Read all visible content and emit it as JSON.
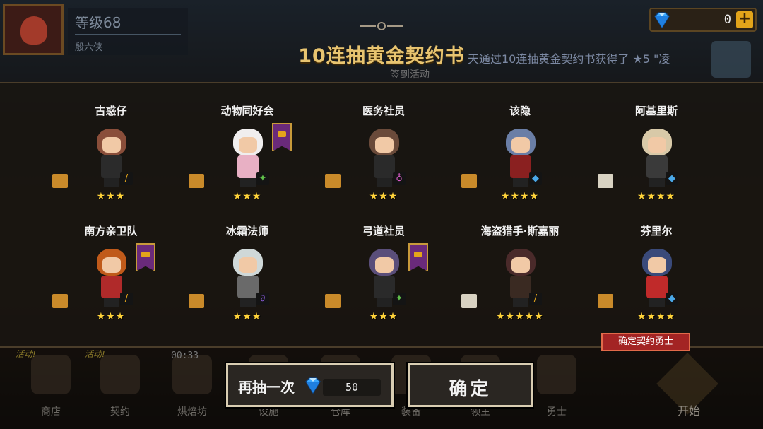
{
  "player": {
    "level": "等级68",
    "name": "殷六侠"
  },
  "currency": {
    "gems": "0",
    "gem_icon": "diamond-icon",
    "plus_icon": "plus-icon"
  },
  "dialog": {
    "title": "10连抽黄金契约书",
    "marquee": "天通过10连抽黄金契约书获得了 ★5 \"凌",
    "sign_label": "签到活动"
  },
  "results": [
    {
      "name": "古惑仔",
      "stars": "★★★",
      "rank": "gold-scroll-icon",
      "class_icon": "sword-icon",
      "hair": "#8a4e3a",
      "outfit": "#2b2b2b",
      "featured": false
    },
    {
      "name": "动物同好会",
      "stars": "★★★",
      "rank": "gold-scroll-icon",
      "class_icon": "shuriken-icon",
      "hair": "#f0eeee",
      "outfit": "#e8b0c4",
      "featured": true
    },
    {
      "name": "医务社员",
      "stars": "★★★",
      "rank": "gold-scroll-icon",
      "class_icon": "potion-icon",
      "hair": "#6a4a3a",
      "outfit": "#2a2a2a",
      "featured": false
    },
    {
      "name": "该隐",
      "stars": "★★★★",
      "rank": "gold-scroll-icon",
      "class_icon": "hammer-icon",
      "hair": "#6a7ea6",
      "outfit": "#8a2020",
      "featured": false
    },
    {
      "name": "阿基里斯",
      "stars": "★★★★",
      "rank": "silver-scroll-icon",
      "class_icon": "hammer-icon",
      "hair": "#d8c9a8",
      "outfit": "#3a3a3a",
      "featured": false
    },
    {
      "name": "南方亲卫队",
      "stars": "★★★",
      "rank": "gold-scroll-icon",
      "class_icon": "sword-icon",
      "hair": "#c05a1a",
      "outfit": "#b02a2a",
      "featured": true
    },
    {
      "name": "冰霜法师",
      "stars": "★★★",
      "rank": "gold-scroll-icon",
      "class_icon": "staff-icon",
      "hair": "#cfd8d8",
      "outfit": "#6a6a6a",
      "featured": false
    },
    {
      "name": "弓道社员",
      "stars": "★★★",
      "rank": "gold-scroll-icon",
      "class_icon": "shuriken-icon",
      "hair": "#5a4e7a",
      "outfit": "#2a2a2a",
      "featured": true
    },
    {
      "name": "海盗猎手·斯嘉丽",
      "stars": "★★★★★",
      "rank": "silver-scroll-icon",
      "class_icon": "sword-icon",
      "hair": "#4a2a2a",
      "outfit": "#3a2a22",
      "featured": false
    },
    {
      "name": "芬里尔",
      "stars": "★★★★",
      "rank": "gold-scroll-icon",
      "class_icon": "hammer-icon",
      "hair": "#3a4a7a",
      "outfit": "#c02a2a",
      "featured": false
    }
  ],
  "confirm_tag": "确定契约勇士",
  "nav": {
    "timer": "00:33",
    "items": [
      {
        "label": "商店",
        "badge": "活动!"
      },
      {
        "label": "契约",
        "badge": "活动!"
      },
      {
        "label": "烘焙坊",
        "badge": ""
      },
      {
        "label": "设施",
        "badge": ""
      },
      {
        "label": "仓库",
        "badge": ""
      },
      {
        "label": "装备",
        "badge": ""
      },
      {
        "label": "领主",
        "badge": ""
      },
      {
        "label": "勇士",
        "badge": ""
      }
    ],
    "start_label": "开始"
  },
  "actions": {
    "retry_label": "再抽一次",
    "retry_cost": "50",
    "ok_label": "确定"
  },
  "colors": {
    "title": "#e8c470",
    "star": "#ffd33a",
    "tag": "#a32424",
    "gem": "#3aa8ff"
  }
}
